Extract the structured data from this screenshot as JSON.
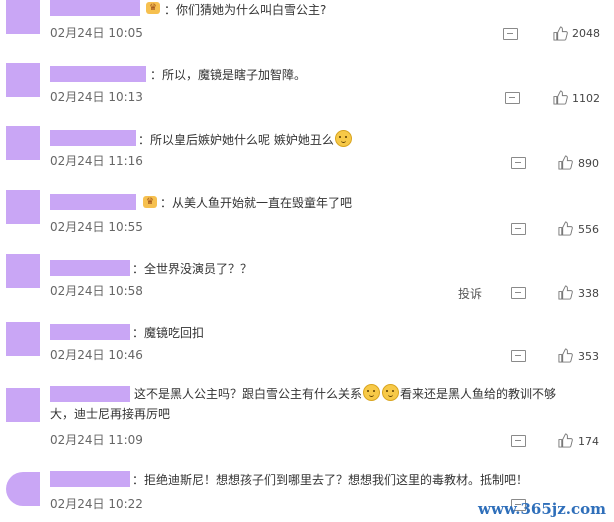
{
  "comments": [
    {
      "text": "：你们猜她为什么叫白雪公主?",
      "time": "02月24日 10:05",
      "likes": "2048"
    },
    {
      "text": "：所以，魔镜是瞎子加智障。",
      "time": "02月24日 10:13",
      "likes": "1102"
    },
    {
      "text": "：所以皇后嫉妒她什么呢 嫉妒她丑么",
      "time": "02月24日 11:16",
      "likes": "890"
    },
    {
      "text": "：从美人鱼开始就一直在毁童年了吧",
      "time": "02月24日 10:55",
      "likes": "556"
    },
    {
      "text": "：全世界没演员了？？",
      "time": "02月24日 10:58",
      "likes": "338",
      "report": "投诉"
    },
    {
      "text": "：魔镜吃回扣",
      "time": "02月24日 10:46",
      "likes": "353"
    },
    {
      "text_a": "这不是黑人公主吗？跟白雪公主有什么关系",
      "text_b": "看来还是黑人鱼给的教训不够大，迪士尼再接再厉吧",
      "time": "02月24日 11:09",
      "likes": "174"
    },
    {
      "text": "：拒绝迪斯尼！想想孩子们到哪里去了？想想我们这里的毒教材。抵制吧！",
      "time": "02月24日 10:22"
    }
  ],
  "watermark": "www.365jz.com",
  "icons": {
    "comment": "comment-icon",
    "like": "thumbs-up-icon",
    "badge": "vip-crown-badge",
    "emoji": "smile-emoji"
  },
  "colors": {
    "mask": "#c9a6f5",
    "watermark": "#2f6fba"
  }
}
